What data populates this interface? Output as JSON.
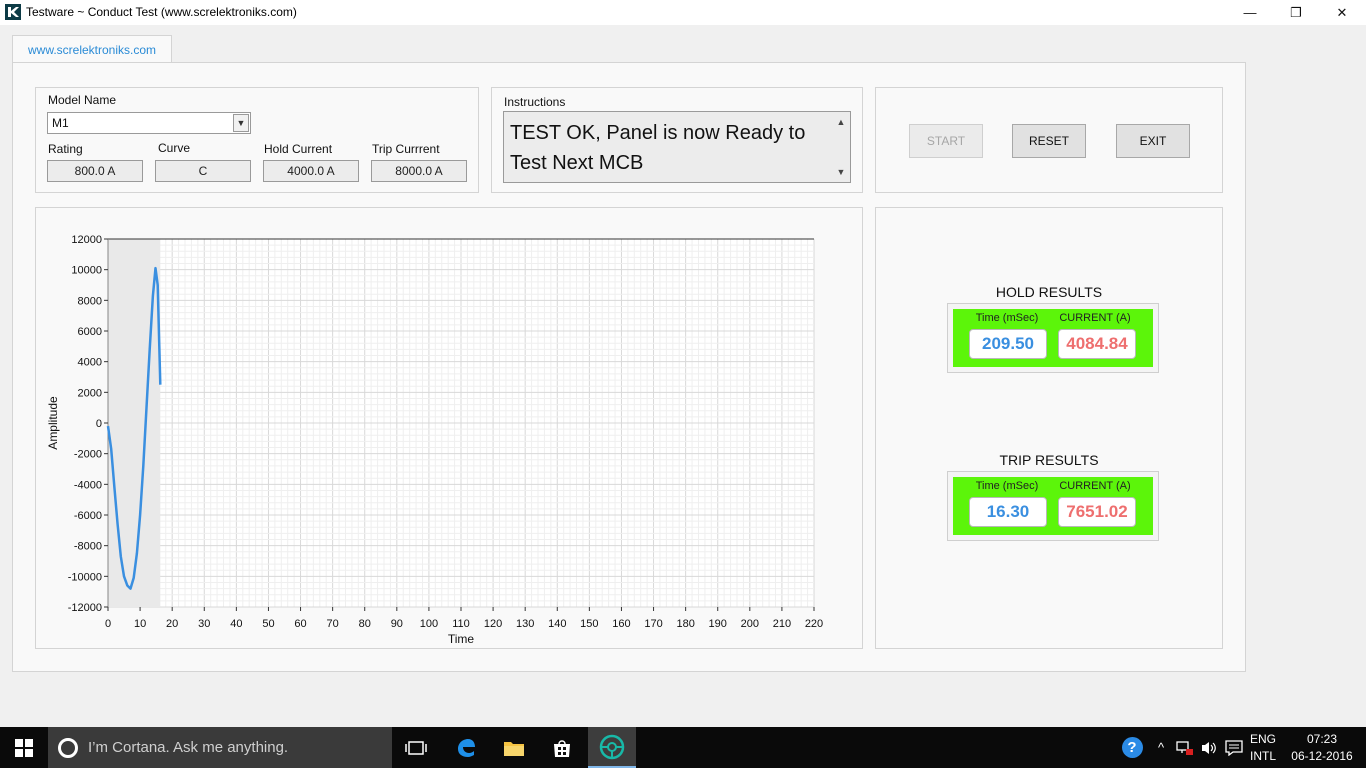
{
  "window": {
    "title": "Testware ~ Conduct Test (www.screlektroniks.com)",
    "minimize_icon": "—",
    "maximize_icon": "❐",
    "close_icon": "✕"
  },
  "tab": {
    "label": "www.screlektroniks.com"
  },
  "model": {
    "name_label": "Model Name",
    "name_value": "M1",
    "rating_label": "Rating",
    "rating_value": "800.0 A",
    "curve_label": "Curve",
    "curve_value": "C",
    "hold_label": "Hold Current",
    "hold_value": "4000.0 A",
    "trip_label": "Trip Currrent",
    "trip_value": "8000.0 A"
  },
  "instructions": {
    "label": "Instructions",
    "text": "TEST OK, Panel is now Ready to Test Next MCB"
  },
  "buttons": {
    "start": "START",
    "reset": "RESET",
    "exit": "EXIT"
  },
  "hold_results": {
    "title": "HOLD RESULTS",
    "time_label": "Time (mSec)",
    "current_label": "CURRENT (A)",
    "time_value": "209.50",
    "current_value": "4084.84"
  },
  "trip_results": {
    "title": "TRIP RESULTS",
    "time_label": "Time (mSec)",
    "current_label": "CURRENT (A)",
    "time_value": "16.30",
    "current_value": "7651.02"
  },
  "colors": {
    "series": "#3a8fe0",
    "time_value": "#3a8fe0",
    "current_value": "#ee6f6f",
    "result_bg": "#5cf50a",
    "tab_text": "#2a8bd6"
  },
  "chart_data": {
    "type": "line",
    "xlabel": "Time",
    "ylabel": "Amplitude",
    "xlim": [
      0,
      220
    ],
    "ylim": [
      -12000,
      12000
    ],
    "x_ticks": [
      0,
      10,
      20,
      30,
      40,
      50,
      60,
      70,
      80,
      90,
      100,
      110,
      120,
      130,
      140,
      150,
      160,
      170,
      180,
      190,
      200,
      210,
      220
    ],
    "y_ticks": [
      12000,
      10000,
      8000,
      6000,
      4000,
      2000,
      0,
      -2000,
      -4000,
      -6000,
      -8000,
      -10000,
      -12000
    ],
    "grid": true,
    "shaded_x_range": [
      0,
      16.3
    ],
    "series": [
      {
        "x": [
          0,
          1,
          2,
          3,
          4,
          5,
          6,
          7,
          8,
          9,
          10,
          11,
          12,
          13,
          14,
          14.8,
          15.5,
          16,
          16.3
        ],
        "y": [
          -200,
          -1700,
          -4200,
          -6600,
          -8700,
          -10000,
          -10600,
          -10800,
          -10100,
          -8500,
          -6000,
          -2800,
          1000,
          4800,
          8300,
          10100,
          9000,
          5000,
          2500
        ]
      }
    ]
  },
  "taskbar": {
    "search_text": "I’m Cortana. Ask me anything.",
    "lang_top": "ENG",
    "lang_bottom": "INTL",
    "time": "07:23",
    "date": "06-12-2016",
    "help_icon": "?",
    "chevron_icon": "^"
  }
}
